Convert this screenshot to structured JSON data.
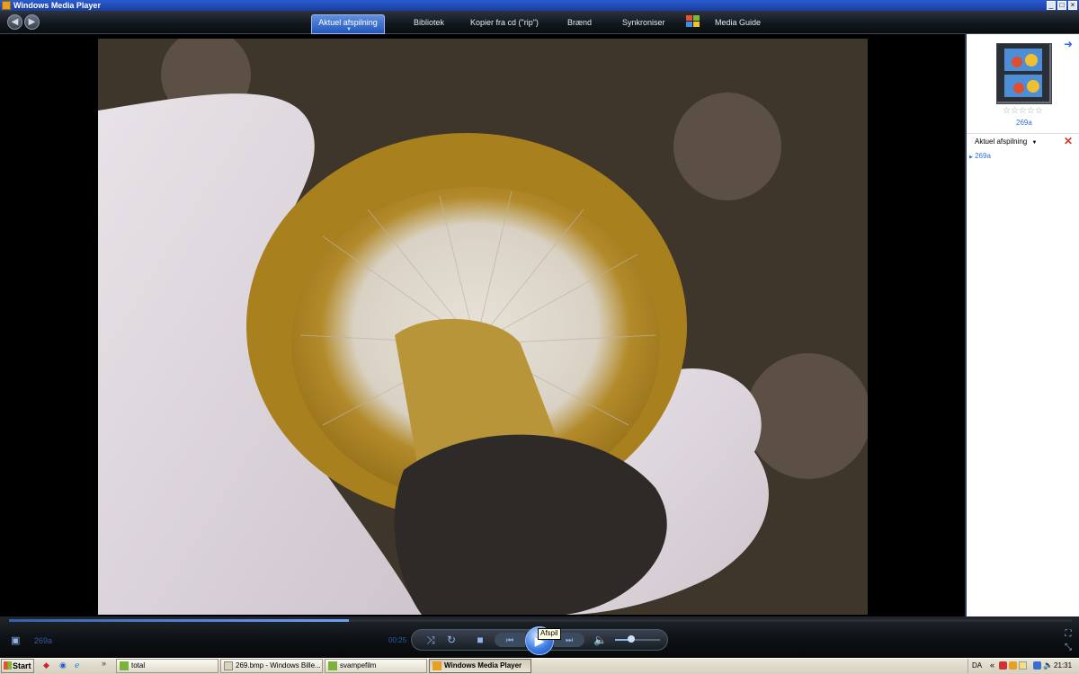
{
  "window": {
    "title": "Windows Media Player",
    "min": "_",
    "max": "□",
    "close": "×"
  },
  "nav": {
    "back_icon": "arrow-left-icon",
    "forward_icon": "arrow-right-icon",
    "tabs": [
      {
        "label": "Aktuel afspilning",
        "active": true
      },
      {
        "label": "Bibliotek"
      },
      {
        "label": "Kopier fra cd (\"rip\")"
      },
      {
        "label": "Brænd"
      },
      {
        "label": "Synkroniser"
      },
      {
        "label": "Media Guide"
      }
    ]
  },
  "now_playing_panel": {
    "thumbnail_title": "269a",
    "rating_stars": "☆☆☆☆☆",
    "header": "Aktuel afspilning",
    "playlist": [
      "269a"
    ]
  },
  "controls": {
    "track_name": "269a",
    "elapsed": "00:25",
    "tooltip": "Afspil",
    "seek_progress": 0.32,
    "volume_level": 0.35
  },
  "taskbar": {
    "start": "Start",
    "tasks": [
      {
        "label": "total",
        "active": false
      },
      {
        "label": "269.bmp - Windows Bille...",
        "active": false
      },
      {
        "label": "svampefilm",
        "active": false
      },
      {
        "label": "Windows Media Player",
        "active": true
      }
    ],
    "language": "DA",
    "clock": "21:31"
  },
  "colors": {
    "accent": "#2456b8",
    "link": "#2f6fd8",
    "close_red": "#d23a2a"
  }
}
